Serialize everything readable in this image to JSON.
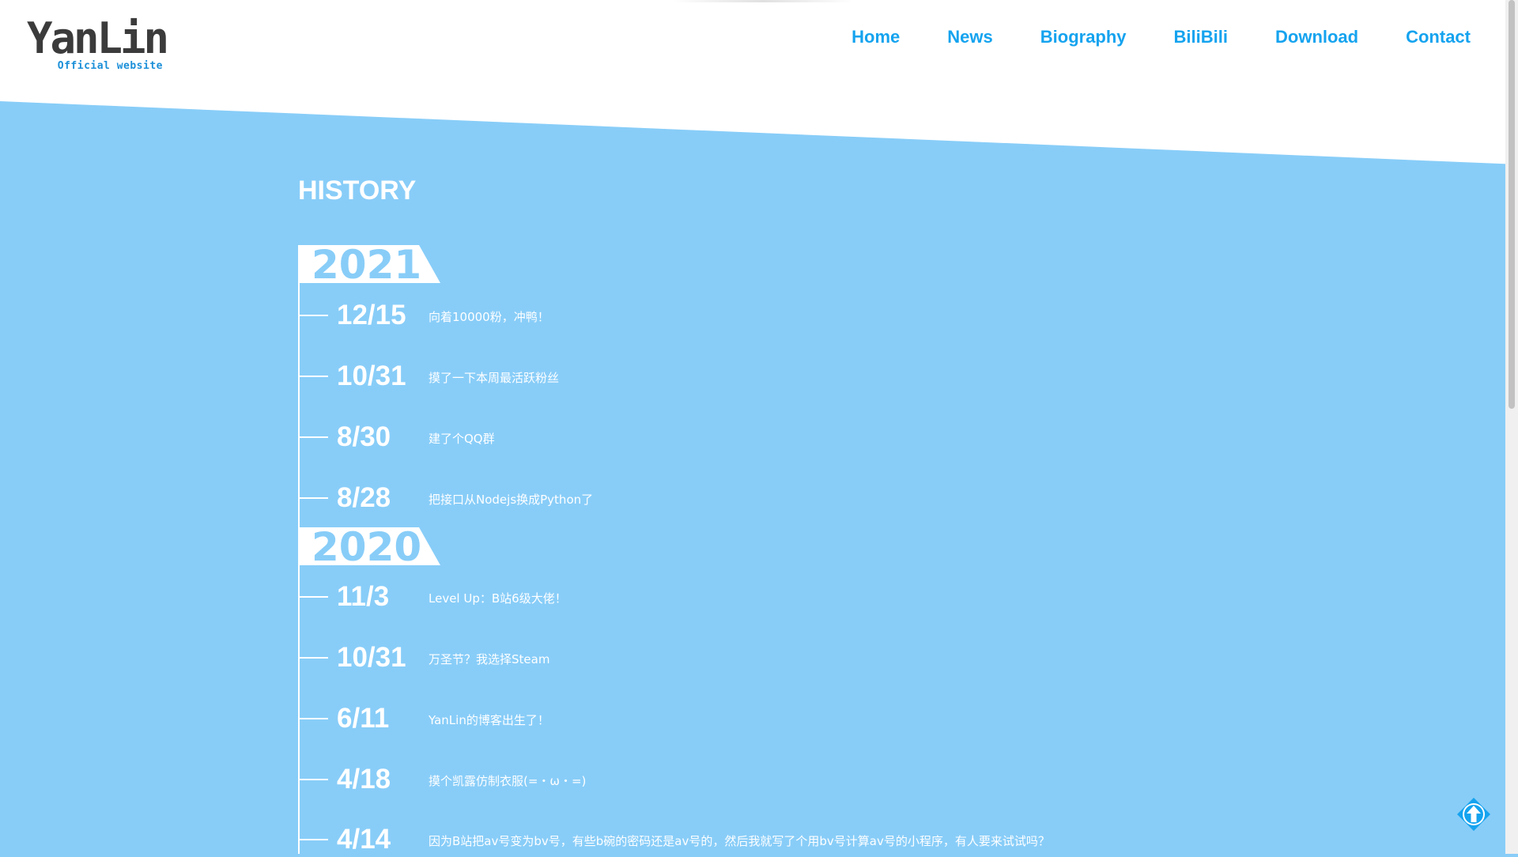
{
  "brand": {
    "logo_main": "YanLin",
    "logo_sub": "Official website",
    "accent_color": "#15a3ef",
    "background_color": "#88cdf8"
  },
  "nav": {
    "items": [
      "Home",
      "News",
      "Biography",
      "BiliBili",
      "Download",
      "Contact"
    ]
  },
  "history": {
    "title": "HISTORY",
    "groups": [
      {
        "year": "2021",
        "entries": [
          {
            "date": "12/15",
            "text": "向着10000粉，冲鸭！"
          },
          {
            "date": "10/31",
            "text": "摸了一下本周最活跃粉丝"
          },
          {
            "date": "8/30",
            "text": "建了个QQ群"
          },
          {
            "date": "8/28",
            "text": "把接口从Nodejs换成Python了"
          }
        ]
      },
      {
        "year": "2020",
        "entries": [
          {
            "date": "11/3",
            "text": "Level Up：B站6级大佬！"
          },
          {
            "date": "10/31",
            "text": "万圣节？我选择Steam"
          },
          {
            "date": "6/11",
            "text": "YanLin的博客出生了！"
          },
          {
            "date": "4/18",
            "text": "摸个凯露仿制衣服(=・ω・=)"
          },
          {
            "date": "4/14",
            "text": "因为B站把av号变为bv号，有些b碗的密码还是av号的，然后我就写了个用bv号计算av号的小程序，有人要来试试吗？"
          }
        ]
      }
    ]
  },
  "icons": {
    "scroll_top": "arrow-up-circle-icon"
  }
}
